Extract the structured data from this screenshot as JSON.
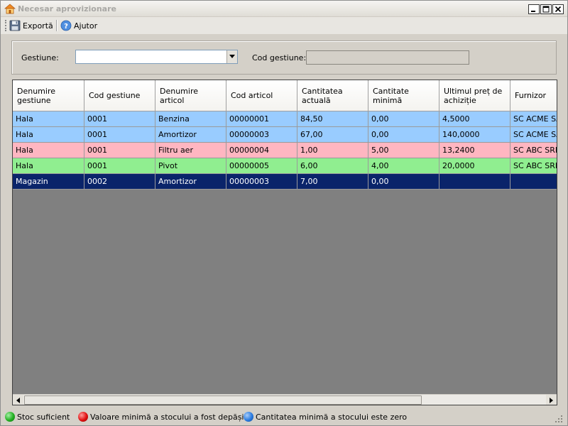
{
  "window": {
    "title": "Necesar aprovizionare"
  },
  "toolbar": {
    "export_label": "Exportă",
    "help_label": "Ajutor"
  },
  "filter": {
    "gestiune_label": "Gestiune:",
    "gestiune_value": "",
    "cod_gestiune_label": "Cod gestiune:",
    "cod_gestiune_value": ""
  },
  "table": {
    "columns": [
      "Denumire\ngestiune",
      "Cod gestiune",
      "Denumire\narticol",
      "Cod articol",
      "Cantitatea\nactuală",
      "Cantitate\nminimă",
      "Ultimul preț de\nachiziție",
      "Furnizor"
    ],
    "rows": [
      {
        "cells": [
          "Hala",
          "0001",
          "Benzina",
          "00000001",
          "84,50",
          "0,00",
          "4,5000",
          "SC ACME SA"
        ],
        "color": "#99ccff",
        "text": "#000000"
      },
      {
        "cells": [
          "Hala",
          "0001",
          "Amortizor",
          "00000003",
          "67,00",
          "0,00",
          "140,0000",
          "SC ACME SA"
        ],
        "color": "#99ccff",
        "text": "#000000"
      },
      {
        "cells": [
          "Hala",
          "0001",
          "Filtru aer",
          "00000004",
          "1,00",
          "5,00",
          "13,2400",
          "SC ABC SRL"
        ],
        "color": "#ffb6c1",
        "text": "#000000"
      },
      {
        "cells": [
          "Hala",
          "0001",
          "Pivot",
          "00000005",
          "6,00",
          "4,00",
          "20,0000",
          "SC ABC SRL"
        ],
        "color": "#90ee90",
        "text": "#000000"
      },
      {
        "cells": [
          "Magazin",
          "0002",
          "Amortizor",
          "00000003",
          "7,00",
          "0,00",
          "",
          ""
        ],
        "color": "#0a246a",
        "text": "#ffffff"
      }
    ]
  },
  "status": {
    "legend": [
      {
        "label": "Stoc suficient",
        "color": "#22b022"
      },
      {
        "label": "Valoare minimă a stocului a fost depășită",
        "color": "#e01010"
      },
      {
        "label": "Cantitatea minimă a stocului este zero",
        "color": "#2a7be0"
      }
    ]
  }
}
